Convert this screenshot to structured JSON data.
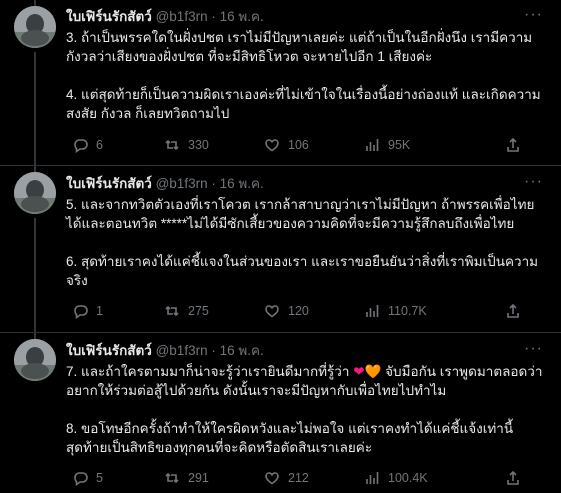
{
  "tweets": [
    {
      "name": "ใบเฟิร์นรักสัตว์",
      "handle": "@b1f3rn",
      "dot": "·",
      "date": "16 พ.ค.",
      "more": "···",
      "paragraphs": [
        "3. ถ้าเป็นพรรคใดในฝั่งปชต เราไม่มีปัญหาเลยค่ะ แต่ถ้าเป็นในอีกฝั่งนึง เรามีความกังวลว่าเสียงของฝั่งปชต ที่จะมีสิทธิโหวต จะหายไปอีก 1 เสียงค่ะ",
        "4. แต่สุดท้ายก็เป็นความผิดเราเองค่ะที่ไม่เข้าใจในเรื่องนี้อย่างถ่องแท้ และเกิดความสงสัย กังวล ก็เลยทวิตถามไป"
      ],
      "replies": "6",
      "retweets": "330",
      "likes": "106",
      "views": "95K"
    },
    {
      "name": "ใบเฟิร์นรักสัตว์",
      "handle": "@b1f3rn",
      "dot": "·",
      "date": "16 พ.ค.",
      "more": "···",
      "paragraphs": [
        "5. และจากทวิตตัวเองที่เราโควต เรากล้าสาบาญว่าเราไม่มีปัญหา ถ้าพรรคเพื่อไทยได้และตอนทวิต *****ไม่ได้มีซักเสี้ยวของความคิดที่จะมีความรู้สึกลบถึงเพื่อไทย",
        "6. สุดท้ายเราคงได้แค่ชี้แจงในส่วนของเรา และเราขอยืนยันว่าสิ่งที่เราพิมเป็นความจริง"
      ],
      "replies": "1",
      "retweets": "275",
      "likes": "120",
      "views": "110.7K"
    },
    {
      "name": "ใบเฟิร์นรักสัตว์",
      "handle": "@b1f3rn",
      "dot": "·",
      "date": "16 พ.ค.",
      "more": "···",
      "p1_before": "7. และถ้าใครตามมาก็น่าจะรู้ว่าเรายินดีมากที่รู้ว่า ",
      "emoji_heart": "❤",
      "emoji_orange": "🧡",
      "p1_after": " จับมือกัน เราพูดมาตลอดว่าอยากให้ร่วมต่อสู้ไปด้วยกัน ดังนั้นเราจะมีปัญหากับเพื่อไทยไปทำไม",
      "paragraphs": [
        "8. ขอโทษอีกครั้งถ้าทำให้ใครผิดหวังและไม่พอใจ แต่เราคงทำได้แค่ชี้แจ้งเท่านี้ สุดท้ายเป็นสิทธิของทุกคนที่จะคิดหรือตัดสินเราเลยค่ะ"
      ],
      "replies": "5",
      "retweets": "291",
      "likes": "212",
      "views": "100.4K"
    }
  ]
}
